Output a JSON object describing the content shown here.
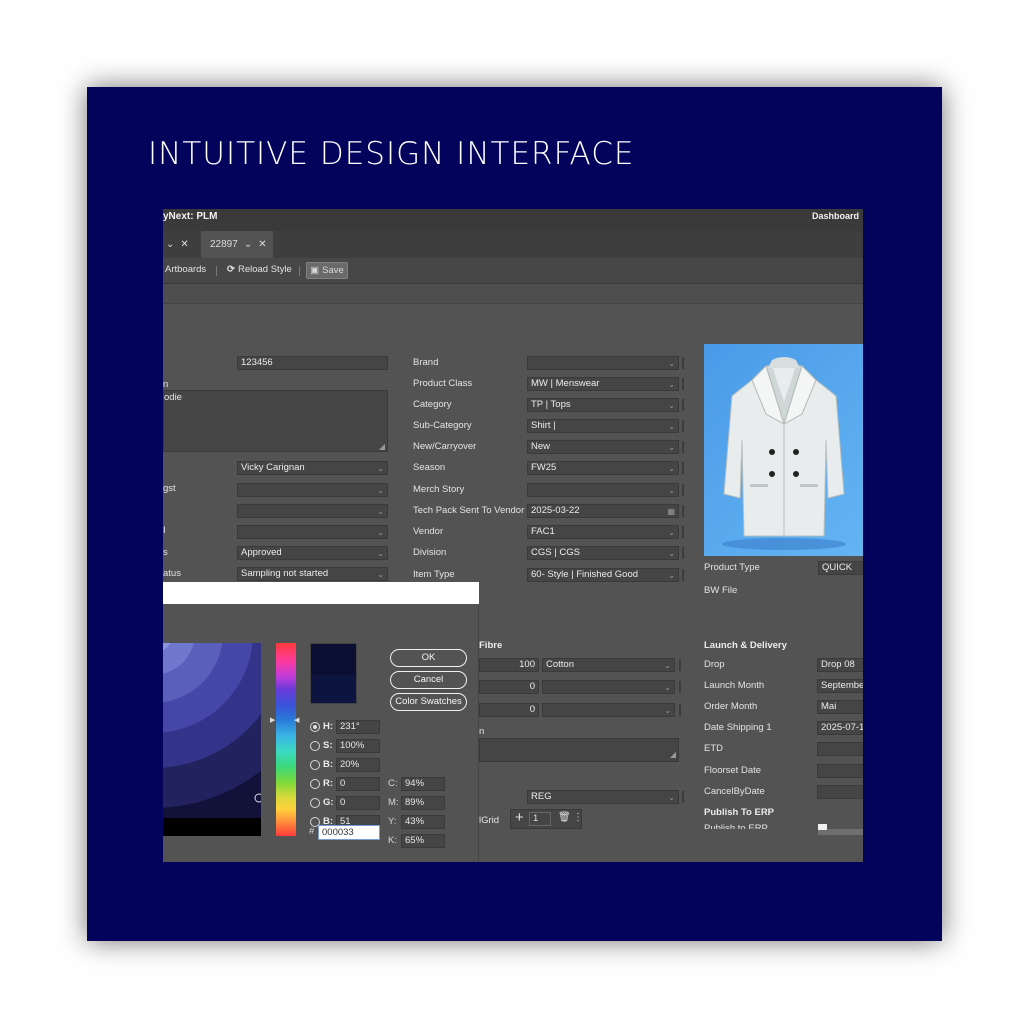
{
  "hero": {
    "title": "INTUITIVE DESIGN INTERFACE"
  },
  "app": {
    "title": "yNext: PLM",
    "dashboard_link": "Dashboard"
  },
  "tabs": [
    {
      "label": ""
    },
    {
      "label": "22897"
    }
  ],
  "toolbar": {
    "artboards_label": "Artboards",
    "reload_label": "Reload Style",
    "save_label": "Save"
  },
  "left_form": {
    "style_number_value": "123456",
    "description_label_frag": "n",
    "description_value_frag": "odie",
    "designer_value": "Vicky Carignan",
    "row2_label_frag": "gst",
    "row4_label_frag": "I",
    "status_label_frag": "s",
    "status_value": "Approved",
    "sample_status_label_frag": "atus",
    "sample_status_value": "Sampling not started"
  },
  "mid_form": {
    "rows": [
      {
        "label": "Brand",
        "value": ""
      },
      {
        "label": "Product Class",
        "value": "MW | Menswear"
      },
      {
        "label": "Category",
        "value": "TP | Tops"
      },
      {
        "label": "Sub-Category",
        "value": "Shirt |"
      },
      {
        "label": "New/Carryover",
        "value": "New"
      },
      {
        "label": "Season",
        "value": "FW25"
      },
      {
        "label": "Merch Story",
        "value": ""
      },
      {
        "label": "Tech Pack Sent To Vendor",
        "value": "2025-03-22"
      },
      {
        "label": "Vendor",
        "value": "FAC1"
      },
      {
        "label": "Division",
        "value": "CGS | CGS"
      },
      {
        "label": "Item Type",
        "value": "60- Style | Finished Good"
      }
    ]
  },
  "product": {
    "product_type_label": "Product Type",
    "product_type_value": "QUICK",
    "bw_file_label": "BW File"
  },
  "fibre": {
    "header": "Fibre",
    "rows": [
      {
        "percent": "100",
        "material": "Cotton"
      },
      {
        "percent": "0",
        "material": ""
      },
      {
        "percent": "0",
        "material": ""
      }
    ],
    "notes_label_frag": "n",
    "size_value": "REG",
    "grid_label_frag": "lGrid",
    "grid_count": "1"
  },
  "launch": {
    "header": "Launch & Delivery",
    "rows": [
      {
        "label": "Drop",
        "value": "Drop 08"
      },
      {
        "label": "Launch Month",
        "value": "Septembe"
      },
      {
        "label": "Order Month",
        "value": "Mai"
      },
      {
        "label": "Date Shipping 1",
        "value": "2025-07-1"
      },
      {
        "label": "ETD",
        "value": ""
      },
      {
        "label": "Floorset Date",
        "value": ""
      },
      {
        "label": "CancelByDate",
        "value": ""
      }
    ],
    "publish_header": "Publish To ERP",
    "publish_row_label": "Publish to ERP"
  },
  "color_picker": {
    "ok_label": "OK",
    "cancel_label": "Cancel",
    "swatches_label": "Color Swatches",
    "hsb": [
      {
        "label": "H:",
        "value": "231°",
        "selected": true
      },
      {
        "label": "S:",
        "value": "100%",
        "selected": false
      },
      {
        "label": "B:",
        "value": "20%",
        "selected": false
      }
    ],
    "rgb": [
      {
        "label": "R:",
        "value": "0"
      },
      {
        "label": "G:",
        "value": "0"
      },
      {
        "label": "B:",
        "value": "51"
      }
    ],
    "cmyk": [
      {
        "label": "C:",
        "value": "94%"
      },
      {
        "label": "M:",
        "value": "89%"
      },
      {
        "label": "Y:",
        "value": "43%"
      },
      {
        "label": "K:",
        "value": "65%"
      }
    ],
    "hex_label": "#",
    "hex_value": "000033",
    "current_color": "#000033"
  },
  "colors": {
    "brand_navy": "#03035c",
    "panel_gray": "#535353",
    "sky_blue": "#5aaaf0"
  }
}
